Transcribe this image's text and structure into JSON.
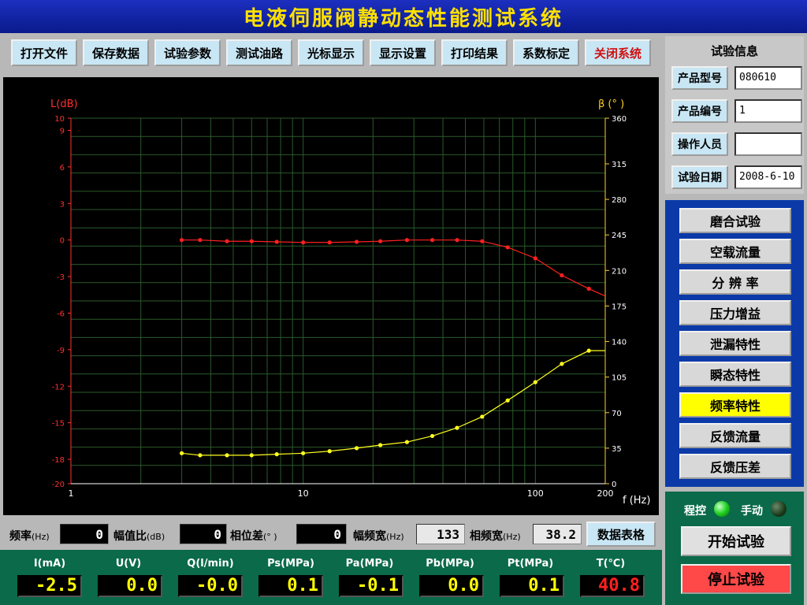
{
  "title": "电液伺服阀静动态性能测试系统",
  "toolbar": [
    "打开文件",
    "保存数据",
    "试验参数",
    "测试油路",
    "光标显示",
    "显示设置",
    "打印结果",
    "系数标定",
    "关闭系统"
  ],
  "colors": {
    "amplitude": "#ff2020",
    "phase": "#ffff20",
    "grid": "#2a5a2a",
    "active": "#ffff00"
  },
  "chart_data": {
    "type": "line",
    "x_scale": "log",
    "xlim": [
      1,
      200
    ],
    "x_ticks": [
      "1",
      "10",
      "100",
      "200"
    ],
    "xlabel": "f (Hz)",
    "ylabel_left": "L(dB)",
    "ylabel_right": "β (° )",
    "y_left_ticks": [
      "10",
      "9",
      "6",
      "3",
      "0",
      "-3",
      "-6",
      "-9",
      "-12",
      "-15",
      "-18",
      "-20"
    ],
    "y_right_ticks": [
      "360",
      "315",
      "280",
      "245",
      "210",
      "175",
      "140",
      "105",
      "70",
      "35",
      "0"
    ],
    "ylim_left": [
      -20,
      10
    ],
    "ylim_right": [
      0,
      360
    ],
    "grid": true,
    "series": [
      {
        "axis": "left",
        "x": [
          3,
          3.6,
          4.7,
          6,
          7.7,
          10,
          13,
          17,
          21.5,
          28,
          36,
          46,
          59,
          76,
          100,
          130,
          170,
          200
        ],
        "y": [
          0,
          0,
          -0.1,
          -0.1,
          -0.15,
          -0.2,
          -0.2,
          -0.15,
          -0.1,
          0,
          0,
          0,
          -0.1,
          -0.6,
          -1.5,
          -2.9,
          -4.0,
          -4.6
        ]
      },
      {
        "axis": "right",
        "x": [
          3,
          3.6,
          4.7,
          6,
          7.7,
          10,
          13,
          17,
          21.5,
          28,
          36,
          46,
          59,
          76,
          100,
          130,
          170,
          200
        ],
        "y": [
          30,
          28,
          28,
          28,
          29,
          30,
          32,
          35,
          38,
          41,
          47,
          55,
          66,
          82,
          100,
          118,
          131,
          131
        ]
      }
    ]
  },
  "readout": {
    "freq_label": "频率",
    "freq_unit": "(Hz)",
    "freq_value": "0",
    "amp_label": "幅值比",
    "amp_unit": "(dB)",
    "amp_value": "0",
    "phase_label": "相位差",
    "phase_unit": "(° )",
    "phase_value": "0",
    "ampbw_label": "幅频宽",
    "ampbw_unit": "(Hz)",
    "ampbw_value": "133",
    "phbw_label": "相频宽",
    "phbw_unit": "(Hz)",
    "phbw_value": "38.2",
    "table_button": "数据表格"
  },
  "meters": [
    {
      "label": "I(mA)",
      "value": "-2.5"
    },
    {
      "label": "U(V)",
      "value": "0.0"
    },
    {
      "label": "Q(l/min)",
      "value": "-0.0"
    },
    {
      "label": "Ps(MPa)",
      "value": "0.1"
    },
    {
      "label": "Pa(MPa)",
      "value": "-0.1"
    },
    {
      "label": "Pb(MPa)",
      "value": "0.0"
    },
    {
      "label": "Pt(MPa)",
      "value": "0.1"
    },
    {
      "label": "T(℃)",
      "value": "40.8"
    }
  ],
  "info": {
    "title": "试验信息",
    "rows": [
      {
        "label": "产品型号",
        "value": "080610"
      },
      {
        "label": "产品编号",
        "value": "1"
      },
      {
        "label": "操作人员",
        "value": ""
      },
      {
        "label": "试验日期",
        "value": "2008-6-10"
      }
    ]
  },
  "tests": [
    "磨合试验",
    "空载流量",
    "分 辨 率",
    "压力增益",
    "泄漏特性",
    "瞬态特性",
    "频率特性",
    "反馈流量",
    "反馈压差"
  ],
  "active_test": "频率特性",
  "control": {
    "auto_label": "程控",
    "manual_label": "手动",
    "auto_on": true,
    "start": "开始试验",
    "stop": "停止试验"
  }
}
